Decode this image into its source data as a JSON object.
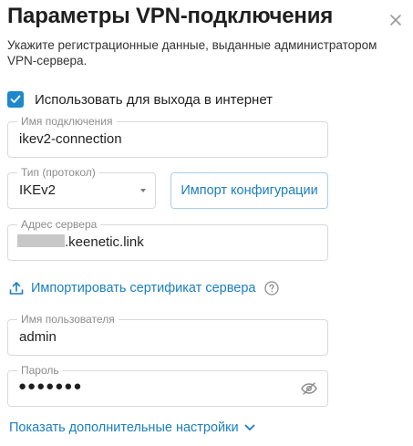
{
  "dialog": {
    "title": "Параметры VPN-подключения",
    "subtitle": "Укажите регистрационные данные, выданные администратором VPN-сервера."
  },
  "use_for_internet": {
    "label": "Использовать для выхода в интернет",
    "checked": true
  },
  "connection_name": {
    "label": "Имя подключения",
    "value": "ikev2-connection"
  },
  "protocol": {
    "label": "Тип (протокол)",
    "value": "IKEv2"
  },
  "import_config_label": "Импорт конфигурации",
  "server_address": {
    "label": "Адрес сервера",
    "value_suffix": ".keenetic.link"
  },
  "import_cert_label": "Импортировать сертификат сервера",
  "username": {
    "label": "Имя пользователя",
    "value": "admin"
  },
  "password": {
    "label": "Пароль",
    "masked_value": "●●●●●●●"
  },
  "show_more_label": "Показать дополнительные настройки",
  "colors": {
    "accent": "#1e88c8",
    "link": "#1a7fbd",
    "border": "#d9d9d9",
    "muted": "#8c8c8c"
  },
  "icons": [
    "close-icon",
    "checkmark-icon",
    "dropdown-arrow-icon",
    "upload-icon",
    "help-icon",
    "eye-off-icon",
    "chevron-down-icon"
  ]
}
